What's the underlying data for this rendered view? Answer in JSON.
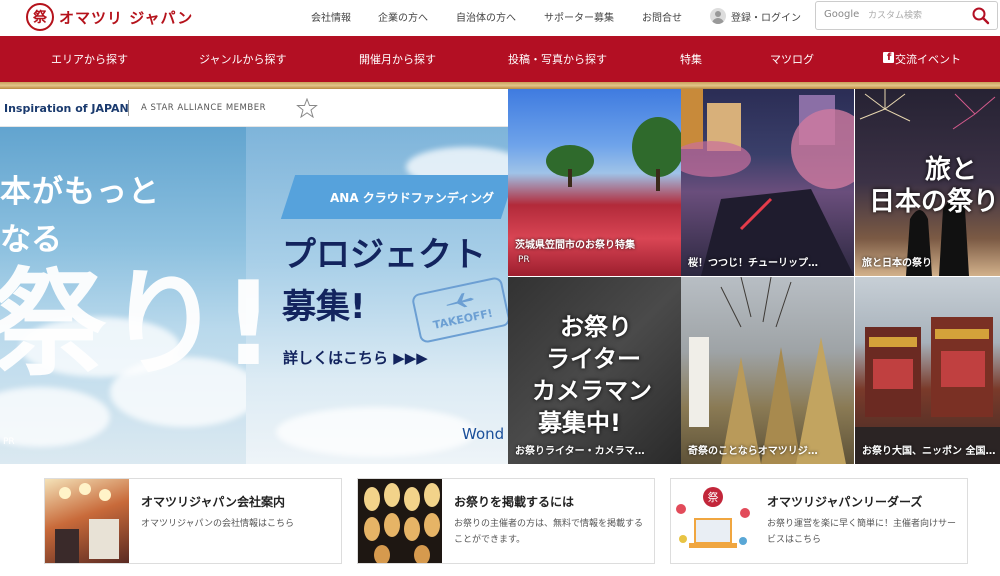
{
  "header": {
    "logo_mark": "祭",
    "logo_text": "オマツリ ジャパン",
    "links": [
      "会社情報",
      "企業の方へ",
      "自治体の方へ",
      "サポーター募集",
      "お問合せ"
    ],
    "login_label": "登録・ログイン",
    "search": {
      "brand": "Google",
      "placeholder": "カスタム検索"
    }
  },
  "nav": {
    "items": [
      "エリアから探す",
      "ジャンルから探す",
      "開催月から探す",
      "投稿・写真から探す",
      "特集",
      "マツログ",
      "交流イベント"
    ],
    "last_icon": "facebook-icon"
  },
  "hero": {
    "inspiration": "Inspiration of JAPAN",
    "star_alliance": "A STAR ALLIANCE MEMBER",
    "line1": "本がもっと",
    "line2": "なる",
    "big": "祭り!",
    "pr": "PR",
    "ribbon": "ANA クラウドファンディング",
    "project": "プロジェクト",
    "boshu": "募集!",
    "takeoff": "TAKEOFF!",
    "detail": "詳しくはこちら ▶▶▶",
    "wond": "Wond"
  },
  "tiles": [
    {
      "caption": "茨城県笠間市のお祭り特集",
      "pr": "PR"
    },
    {
      "caption": "桜！つつじ！チューリップ…"
    },
    {
      "caption": "旅と日本の祭り",
      "overlay": [
        "旅と",
        "日本の祭り"
      ]
    },
    {
      "caption": "お祭りライター・カメラマ…",
      "overlay": [
        "お祭り",
        "ライター",
        "カメラマン",
        "募集中!"
      ]
    },
    {
      "caption": "奇祭のことならオマツリジ…"
    },
    {
      "caption": "お祭り大国、ニッポン 全国…"
    }
  ],
  "cards": [
    {
      "title": "オマツリジャパン会社案内",
      "desc": "オマツリジャパンの会社情報はこちら"
    },
    {
      "title": "お祭りを掲載するには",
      "desc": "お祭りの主催者の方は、無料で情報を掲載することができます。"
    },
    {
      "title": "オマツリジャパンリーダーズ",
      "desc": "お祭り運営を楽に早く簡単に！主催者向けサービスはこちら"
    }
  ],
  "colors": {
    "brand_red": "#b30f23",
    "gold": "#c8a15a",
    "ana_blue": "#13245e"
  }
}
